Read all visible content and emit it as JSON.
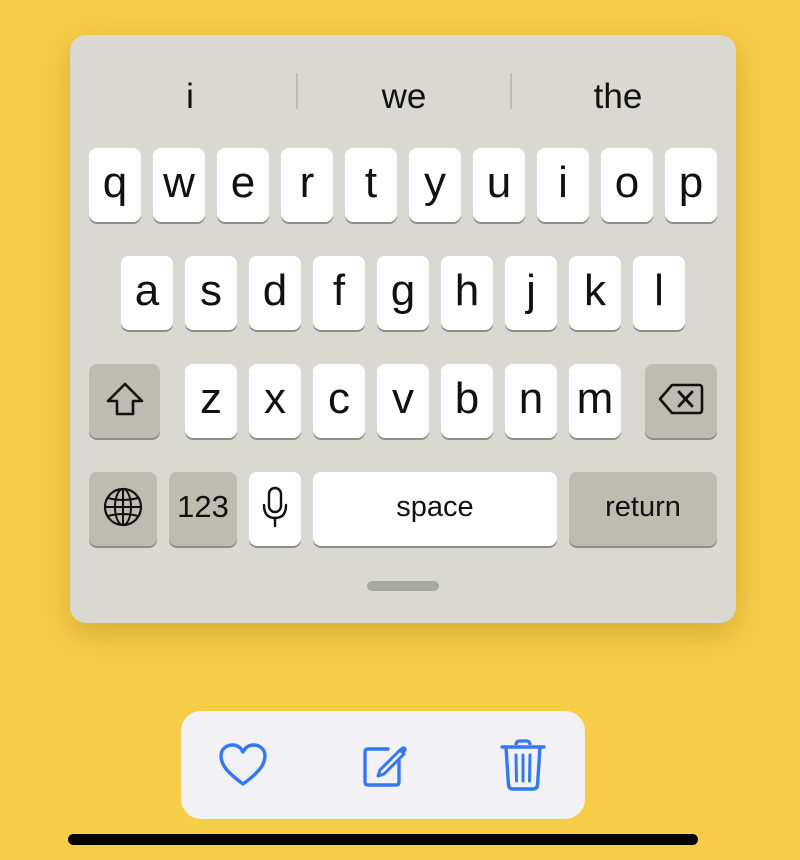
{
  "keyboard": {
    "suggestions": [
      "i",
      "we",
      "the"
    ],
    "rows": [
      [
        "q",
        "w",
        "e",
        "r",
        "t",
        "y",
        "u",
        "i",
        "o",
        "p"
      ],
      [
        "a",
        "s",
        "d",
        "f",
        "g",
        "h",
        "j",
        "k",
        "l"
      ],
      [
        "z",
        "x",
        "c",
        "v",
        "b",
        "n",
        "m"
      ]
    ],
    "shift_icon": "shift-icon",
    "delete_icon": "delete-backward-icon",
    "globe_icon": "globe-icon",
    "numbers_label": "123",
    "mic_icon": "microphone-icon",
    "space_label": "space",
    "return_label": "return"
  },
  "toolbar": {
    "icons": [
      "heart-icon",
      "compose-icon",
      "trash-icon"
    ],
    "accent_color": "#3478f6"
  },
  "colors": {
    "background": "#f7cd47",
    "keyboard_bg": "#d9d9d2",
    "key_bg": "#ffffff",
    "special_key_bg": "#bcbcb0"
  }
}
